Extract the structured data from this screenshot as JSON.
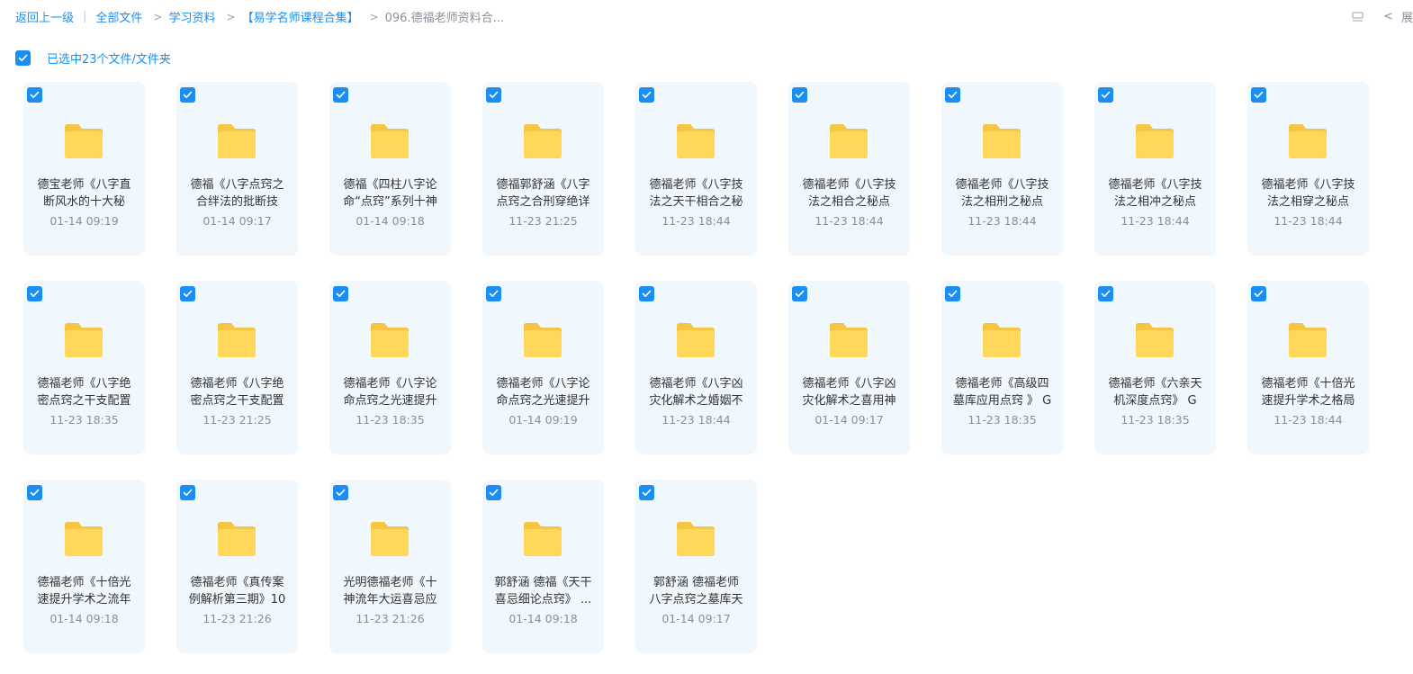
{
  "breadcrumb": {
    "back": "返回上一级",
    "items": [
      "全部文件",
      "学习资料",
      "【易学名师课程合集】"
    ],
    "current": "096.德福老师资料合..."
  },
  "toolbar": {
    "view_icon": "list-view-icon",
    "expand_label": "展"
  },
  "selection": {
    "label": "已选中23个文件/文件夹",
    "checked": true
  },
  "colors": {
    "accent": "#1a8ef5",
    "card_bg": "#f0f7fd",
    "folder_back": "#f6c541",
    "folder_front": "#ffd75a"
  },
  "files": [
    {
      "name": "德宝老师《八字直断风水的十大秘",
      "time": "01-14 09:19"
    },
    {
      "name": "德福《八字点窍之合绊法的批断技",
      "time": "01-14 09:17"
    },
    {
      "name": "德福《四柱八字论命“点窍”系列十神",
      "time": "01-14 09:18"
    },
    {
      "name": "德福郭舒涵《八字点窍之合刑穿绝详",
      "time": "11-23 21:25"
    },
    {
      "name": "德福老师《八字技法之天干相合之秘",
      "time": "11-23 18:44"
    },
    {
      "name": "德福老师《八字技法之相合之秘点",
      "time": "11-23 18:44"
    },
    {
      "name": "德福老师《八字技法之相刑之秘点",
      "time": "11-23 18:44"
    },
    {
      "name": "德福老师《八字技法之相冲之秘点",
      "time": "11-23 18:44"
    },
    {
      "name": "德福老师《八字技法之相穿之秘点",
      "time": "11-23 18:44"
    },
    {
      "name": "德福老师《八字绝密点窍之干支配置",
      "time": "11-23 18:35"
    },
    {
      "name": "德福老师《八字绝密点窍之干支配置",
      "time": "11-23 21:25"
    },
    {
      "name": "德福老师《八字论命点窍之光速提升",
      "time": "11-23 18:35"
    },
    {
      "name": "德福老师《八字论命点窍之光速提升",
      "time": "01-14 09:19"
    },
    {
      "name": "德福老师《八字凶灾化解术之婚姻不",
      "time": "11-23 18:44"
    },
    {
      "name": "德福老师《八字凶灾化解术之喜用神",
      "time": "01-14 09:17"
    },
    {
      "name": "德福老师《高级四墓库应用点窍 》 G",
      "time": "11-23 18:35"
    },
    {
      "name": "德福老师《六亲天机深度点窍》 G",
      "time": "11-23 18:35"
    },
    {
      "name": "德福老师《十倍光速提升学术之格局",
      "time": "11-23 18:44"
    },
    {
      "name": "德福老师《十倍光速提升学术之流年",
      "time": "01-14 09:18"
    },
    {
      "name": "德福老师《真传案例解析第三期》10",
      "time": "11-23 21:26"
    },
    {
      "name": "光明德福老师《十神流年大运喜忌应",
      "time": "11-23 21:26"
    },
    {
      "name": "郭舒涵 德福《天干喜忌细论点窍》 ...",
      "time": "01-14 09:18"
    },
    {
      "name": "郭舒涵 德福老师 八字点窍之墓库天",
      "time": "01-14 09:17"
    }
  ]
}
